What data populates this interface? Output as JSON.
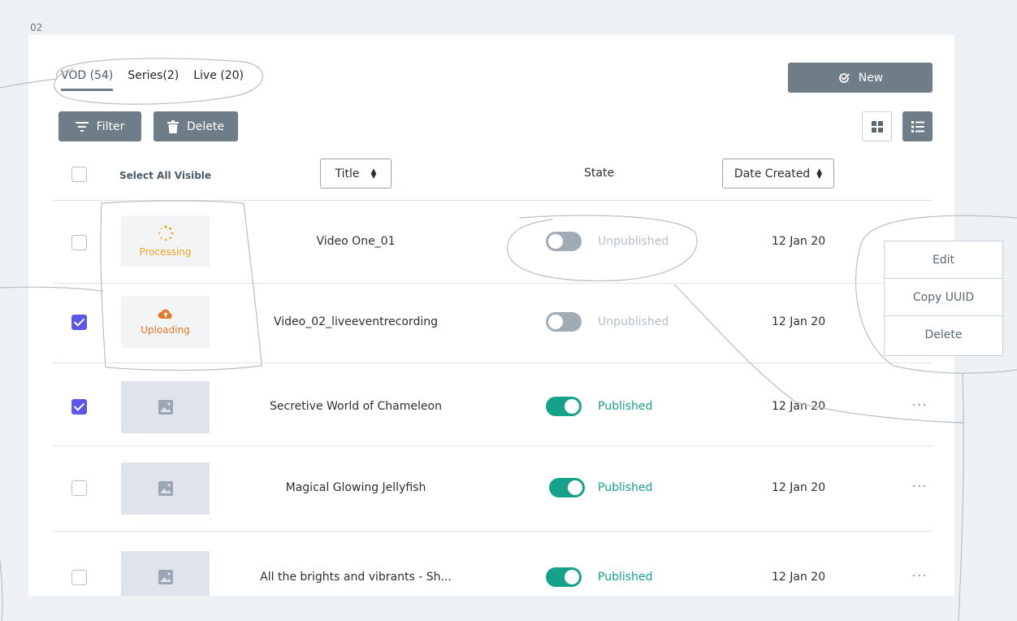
{
  "page_label": "02",
  "tabs": [
    {
      "label": "VOD (54)",
      "active": true
    },
    {
      "label": "Series(2)",
      "active": false
    },
    {
      "label": "Live (20)",
      "active": false
    }
  ],
  "toolbar": {
    "new_label": "New",
    "filter_label": "Filter",
    "delete_label": "Delete"
  },
  "table_header": {
    "select_all": "Select All Visible",
    "title": "Title",
    "state": "State",
    "date_created": "Date Created"
  },
  "rows": [
    {
      "thumb_status": "Processing",
      "title": "Video One_01",
      "state": "Unpublished",
      "date": "12 Jan 20",
      "checked": false
    },
    {
      "thumb_status": "Uploading",
      "title": "Video_02_liveeventrecording",
      "state": "Unpublished",
      "date": "12 Jan 20",
      "checked": true
    },
    {
      "thumb_status": "",
      "title": "Secretive World of Chameleon",
      "state": "Published",
      "date": "12 Jan 20",
      "checked": true,
      "more": "···"
    },
    {
      "thumb_status": "",
      "title": "Magical Glowing Jellyfish",
      "state": "Published",
      "date": "12 Jan 20",
      "checked": false,
      "more": "···"
    },
    {
      "thumb_status": "",
      "title": "All the brights and vibrants - Sh...",
      "state": "Published",
      "date": "12 Jan 20",
      "checked": false,
      "more": "···"
    }
  ],
  "menu": {
    "edit": "Edit",
    "copy_uuid": "Copy UUID",
    "delete": "Delete"
  },
  "colors": {
    "accent": "#6f7d89",
    "published": "#16a28a",
    "checkbox": "#5b57e8",
    "processing": "#f0a31c",
    "uploading": "#e5792a"
  }
}
